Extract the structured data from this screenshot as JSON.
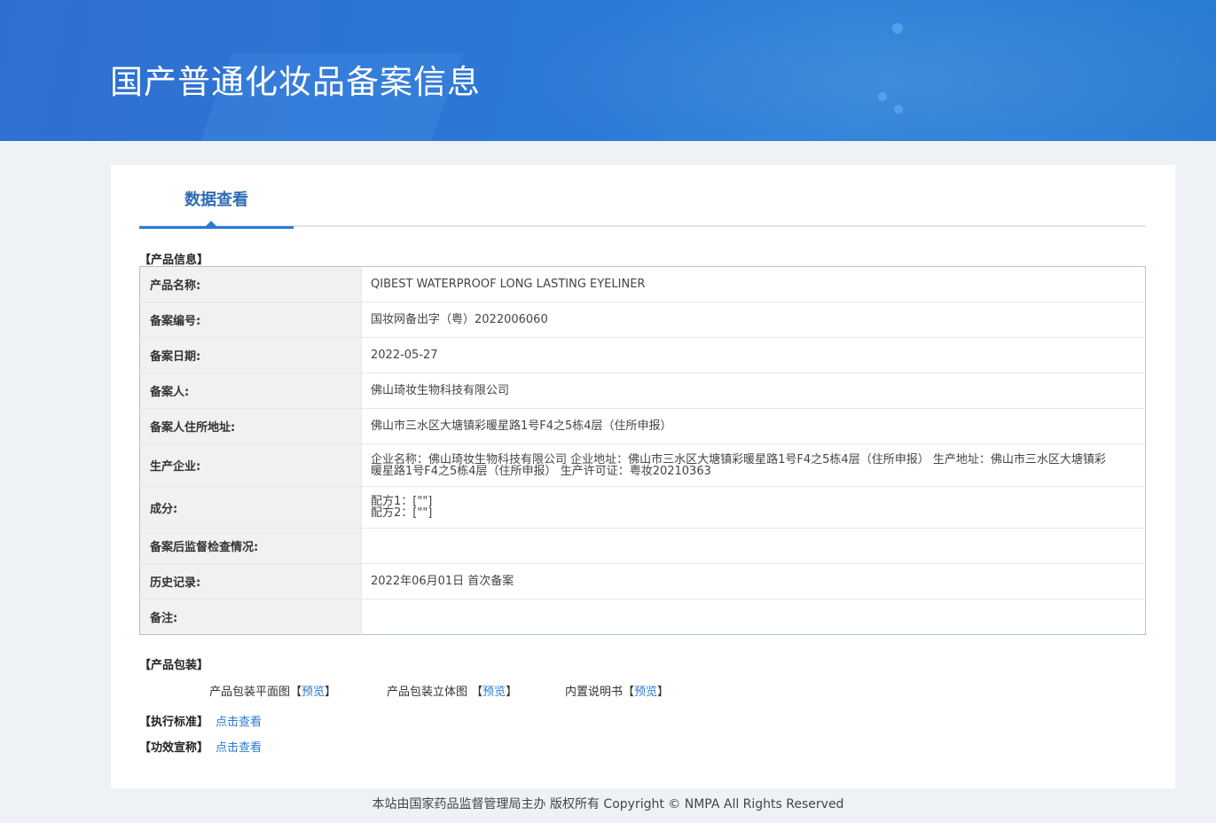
{
  "banner": {
    "title": "国产普通化妆品备案信息"
  },
  "tab": {
    "label": "数据查看"
  },
  "sections": {
    "product_info": "【产品信息】",
    "packaging": "【产品包装】",
    "standard": "【执行标准】",
    "efficacy": "【功效宣称】"
  },
  "info_rows": [
    {
      "key": "产品名称:",
      "value": "QIBEST WATERPROOF LONG LASTING EYELINER"
    },
    {
      "key": "备案编号:",
      "value": "国妆网备出字（粤）2022006060"
    },
    {
      "key": "备案日期:",
      "value": "2022-05-27"
    },
    {
      "key": "备案人:",
      "value": "佛山琦妆生物科技有限公司"
    },
    {
      "key": "备案人住所地址:",
      "value": "佛山市三水区大塘镇彩暖星路1号F4之5栋4层（住所申报）"
    },
    {
      "key": "生产企业:",
      "value": "企业名称：佛山琦妆生物科技有限公司 企业地址：佛山市三水区大塘镇彩暖星路1号F4之5栋4层（住所申报） 生产地址：佛山市三水区大塘镇彩暖星路1号F4之5栋4层（住所申报） 生产许可证：粤妆20210363"
    },
    {
      "key": "成分:",
      "value_lines": [
        "配方1：[\"\"]",
        "配方2：[\"\"]"
      ]
    },
    {
      "key": "备案后监督检查情况:",
      "value": ""
    },
    {
      "key": "历史记录:",
      "value": "2022年06月01日 首次备案"
    },
    {
      "key": "备注:",
      "value": ""
    }
  ],
  "packaging": {
    "flat_label": "产品包装平面图",
    "solid_label": "产品包装立体图",
    "manual_label": "内置说明书",
    "bracket_open": "【",
    "bracket_close": "】",
    "preview": "预览"
  },
  "links": {
    "view": "点击查看"
  },
  "footer": {
    "text": "本站由国家药品监督管理局主办 版权所有 Copyright © NMPA All Rights Reserved"
  }
}
